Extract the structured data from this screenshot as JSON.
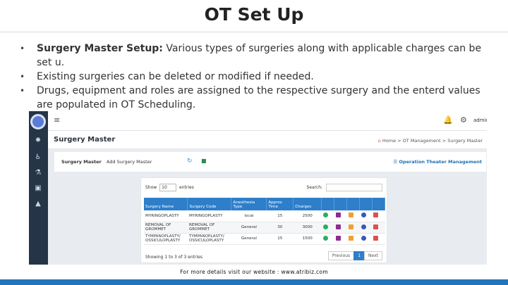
{
  "slide": {
    "title": "OT Set Up",
    "bullets": [
      {
        "bold": "Surgery Master Setup:",
        "text": " Various types of surgeries along with applicable charges can be set u."
      },
      {
        "bold": "",
        "text": "Existing surgeries can be deleted or modified if needed."
      },
      {
        "bold": "",
        "text": "Drugs, equipment and roles are assigned to the respective surgery and the enterd values are populated in OT Scheduling."
      }
    ],
    "caption": "For more details visit our website : www.atribiz.com"
  },
  "app": {
    "user": "admin",
    "page_title": "Surgery Master",
    "breadcrumb": {
      "home": "Home",
      "sep1": ">",
      "ot": "OT Management",
      "sep2": ">",
      "current": "Surgery Master"
    },
    "tabs": {
      "surgery_master": "Surgery Master",
      "add_surgery_master": "Add Surgery Master"
    },
    "ot_management_link": "Operation Theater Management",
    "show_label": "Show",
    "show_value": "10",
    "entries_label": "entries",
    "search_label": "Search:",
    "columns": [
      "Surgery Name",
      "Surgery Code",
      "Anesthesia Type",
      "Approx Time",
      "Charges",
      "",
      "",
      "",
      "",
      ""
    ],
    "rows": [
      {
        "name": "MYRINGOPLASTY",
        "code": "MYRINGOPLASTY",
        "anesthesia": "local",
        "time": "15",
        "charges": "2500"
      },
      {
        "name": "REMOVAL OF GROMMET",
        "code": "REMOVAL OF GROMMET",
        "anesthesia": "General",
        "time": "30",
        "charges": "3000"
      },
      {
        "name": "TYMPANOPLASTY/ OSSICULOPLASTY",
        "code": "TYMPANOPLASTY/ OSSICULOPLASTY",
        "anesthesia": "General",
        "time": "15",
        "charges": "1500"
      }
    ],
    "info": "Showing 1 to 3 of 3 entries",
    "pager": {
      "prev": "Previous",
      "page": "1",
      "next": "Next"
    }
  },
  "colors": {
    "accent": "#2e7ec9",
    "sidebar": "#253446",
    "danger": "#d9534f",
    "footer_bar": "#1f76bd"
  }
}
